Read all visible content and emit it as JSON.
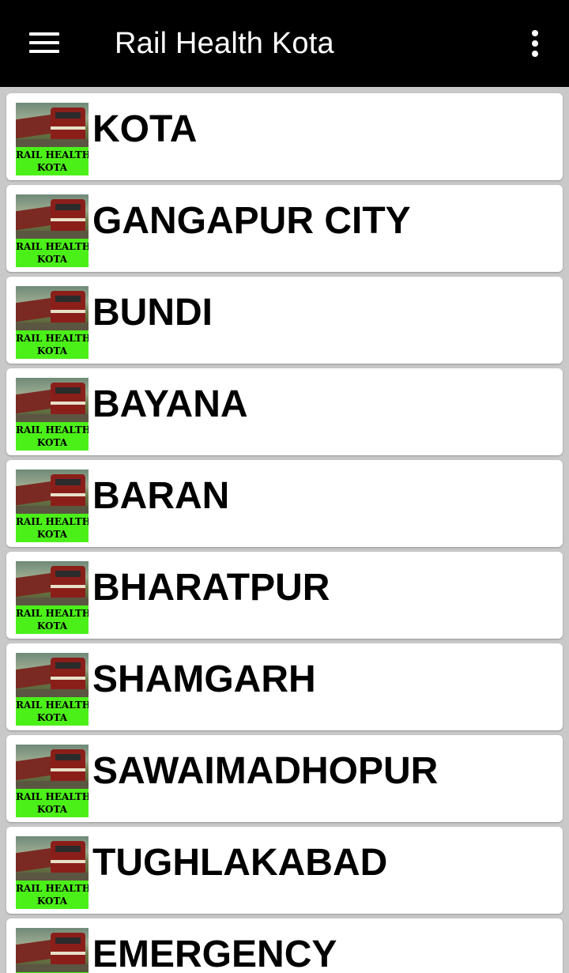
{
  "app": {
    "title": "Rail Health Kota",
    "colors": {
      "appbar": "#000000",
      "background": "#c9c9c9",
      "card": "#ffffff",
      "badge": "#4cf019"
    },
    "icons": {
      "menu": "hamburger-menu-icon",
      "overflow": "more-vertical-icon"
    }
  },
  "thumbnail": {
    "line1": "RAIL HEALTH",
    "line2": "KOTA"
  },
  "stations": [
    "KOTA",
    "GANGAPUR CITY",
    "BUNDI",
    "BAYANA",
    "BARAN",
    "BHARATPUR",
    "SHAMGARH",
    "SAWAIMADHOPUR",
    "TUGHLAKABAD",
    "EMERGENCY"
  ]
}
